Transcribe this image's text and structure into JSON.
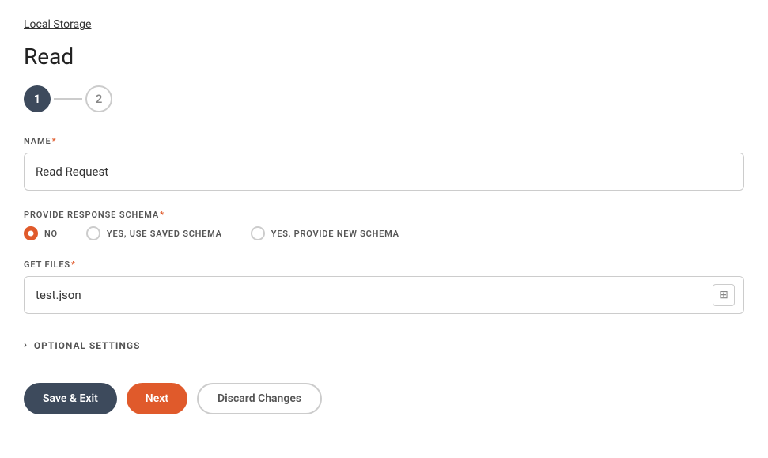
{
  "breadcrumb": {
    "label": "Local Storage"
  },
  "page": {
    "title": "Read"
  },
  "stepper": {
    "step1": "1",
    "step2": "2"
  },
  "form": {
    "name_label": "NAME",
    "name_value": "Read Request",
    "name_placeholder": "",
    "schema_label": "PROVIDE RESPONSE SCHEMA",
    "schema_options": [
      {
        "value": "no",
        "label": "NO",
        "checked": true
      },
      {
        "value": "use_saved",
        "label": "YES, USE SAVED SCHEMA",
        "checked": false
      },
      {
        "value": "new_schema",
        "label": "YES, PROVIDE NEW SCHEMA",
        "checked": false
      }
    ],
    "get_files_label": "GET FILES",
    "get_files_value": "test.json",
    "get_files_placeholder": "",
    "optional_settings_label": "OPTIONAL SETTINGS"
  },
  "buttons": {
    "save_label": "Save & Exit",
    "next_label": "Next",
    "discard_label": "Discard Changes"
  },
  "icons": {
    "chevron_right": "›",
    "input_icon": "⊞"
  }
}
